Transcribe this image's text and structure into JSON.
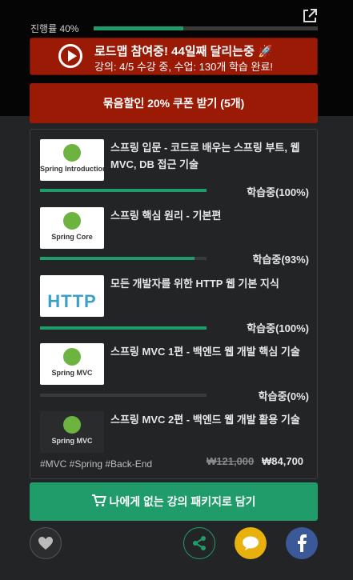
{
  "progress": {
    "label": "진행률 40%",
    "value": 0.4
  },
  "roadmap": {
    "title": "로드맵 참여중! 44일째 달리는중 🚀",
    "subtitle": "강의: 4/5 수강 중, 수업: 130개 학습 완료!"
  },
  "coupon_button": "묶음할인 20% 쿠폰 받기 (5개)",
  "courses": [
    {
      "title": "스프링 입문 - 코드로 배우는 스프링 부트, 웹 MVC, DB 접근 기술",
      "thumb_text": "Spring Introduction",
      "status": "학습중(100%)",
      "progress": 1.0
    },
    {
      "title": "스프링 핵심 원리 - 기본편",
      "thumb_text": "Spring Core",
      "status": "학습중(93%)",
      "progress": 0.93
    },
    {
      "title": "모든 개발자를 위한 HTTP 웹 기본 지식",
      "thumb_text": "HTTP",
      "status": "학습중(100%)",
      "progress": 1.0
    },
    {
      "title": "스프링 MVC 1편 - 백엔드 웹 개발 핵심 기술",
      "thumb_text": "Spring MVC",
      "status": "학습중(0%)",
      "progress": 0.0
    },
    {
      "title": "스프링 MVC 2편 - 백엔드 웹 개발 활용 기술",
      "thumb_text": "Spring MVC"
    }
  ],
  "tags": "#MVC #Spring #Back-End",
  "price": {
    "original": "₩121,000",
    "discounted": "₩84,700"
  },
  "cart_button": "나에게 없는 강의 패키지로 담기",
  "icons": {
    "external": "external-link-icon",
    "play": "play-icon",
    "cart": "cart-icon",
    "like": "heart-icon",
    "share": "share-icon",
    "talk": "speech-bubble-icon",
    "facebook": "facebook-icon"
  },
  "colors": {
    "accent_green": "#1f9c69",
    "accent_red": "#9b1a06",
    "kakao": "#e8b10e",
    "facebook": "#3b5998"
  }
}
